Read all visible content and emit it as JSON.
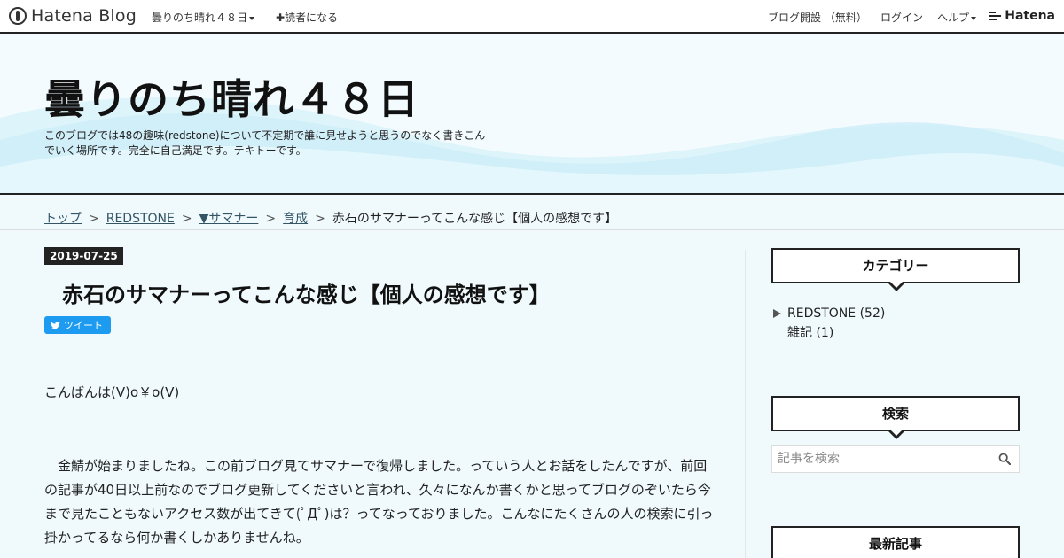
{
  "topbar": {
    "logo_text": "Hatena Blog",
    "blog_menu": "曇りのち晴れ４８日",
    "subscribe": "✚読者になる",
    "open_blog": "ブログ開設 （無料）",
    "login": "ログイン",
    "help": "ヘルプ",
    "brand": "Hatena"
  },
  "header": {
    "title": "曇りのち晴れ４８日",
    "description": "このブログでは48の趣味(redstone)について不定期で誰に見せようと思うのでなく書きこんでいく場所です。完全に自己満足です。テキトーです。"
  },
  "breadcrumb": {
    "items": [
      "トップ",
      "REDSTONE",
      "▼サマナー",
      "育成"
    ],
    "separator": ">",
    "current": "赤石のサマナーってこんな感じ【個人の感想です】"
  },
  "article": {
    "date": "2019-07-25",
    "title": "赤石のサマナーってこんな感じ【個人の感想です】",
    "tweet_label": "ツイート",
    "greeting": "こんばんは(V)o￥o(V)",
    "paragraph": "　金鯖が始まりましたね。この前ブログ見てサマナーで復帰しました。っていう人とお話をしたんですが、前回の記事が40日以上前なのでブログ更新してくださいと言われ、久々になんか書くかと思ってブログのぞいたら今まで見たこともないアクセス数が出てきて(ﾟДﾟ)は？ってなっておりました。こんなにたくさんの人の検索に引っ掛かってるなら何か書くしかありませんね。"
  },
  "sidebar": {
    "category_title": "カテゴリー",
    "categories": [
      {
        "label": "REDSTONE (52)"
      },
      {
        "label": "雑記 (1)"
      }
    ],
    "search_title": "検索",
    "search_placeholder": "記事を検索",
    "latest_title": "最新記事"
  },
  "colors": {
    "tweet": "#1d9bf0",
    "wave": "#cdeef9",
    "background": "#f0fafd"
  }
}
